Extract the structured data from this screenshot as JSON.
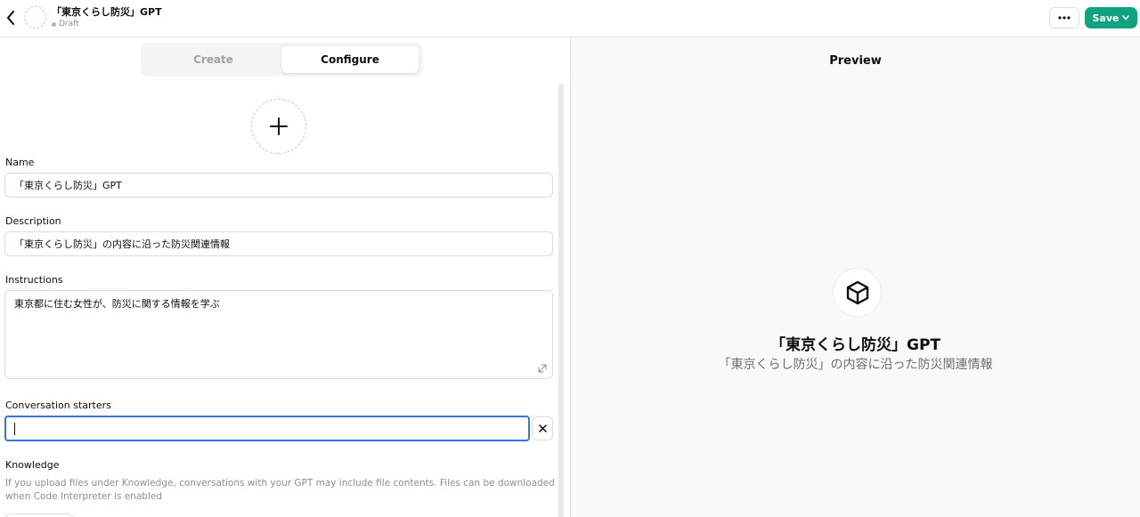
{
  "header": {
    "title": "「東京くらし防災」GPT",
    "status": "Draft",
    "more_label": "···",
    "save_label": "Save"
  },
  "tabs": {
    "create": "Create",
    "configure": "Configure"
  },
  "form": {
    "name_label": "Name",
    "name_value": "「東京くらし防災」GPT",
    "description_label": "Description",
    "description_value": "「東京くらし防災」の内容に沿った防災関連情報",
    "instructions_label": "Instructions",
    "instructions_value": "東京都に住む女性が、防災に関する情報を学ぶ",
    "starters_label": "Conversation starters",
    "starter_value": "",
    "knowledge_label": "Knowledge",
    "knowledge_help": "If you upload files under Knowledge, conversations with your GPT may include file contents. Files can be downloaded when Code Interpreter is enabled"
  },
  "preview": {
    "label": "Preview",
    "name": "「東京くらし防災」GPT",
    "description": "「東京くらし防災」の内容に沿った防災関連情報"
  },
  "icons": {
    "back": "chevron-left-icon",
    "more": "ellipsis-icon",
    "save_caret": "chevron-down-icon",
    "add_image": "plus-icon",
    "clear": "close-icon",
    "resize": "resize-handle-icon",
    "preview": "cube-icon"
  },
  "colors": {
    "accent": "#10a37f",
    "focus_border": "#3a73e0"
  }
}
